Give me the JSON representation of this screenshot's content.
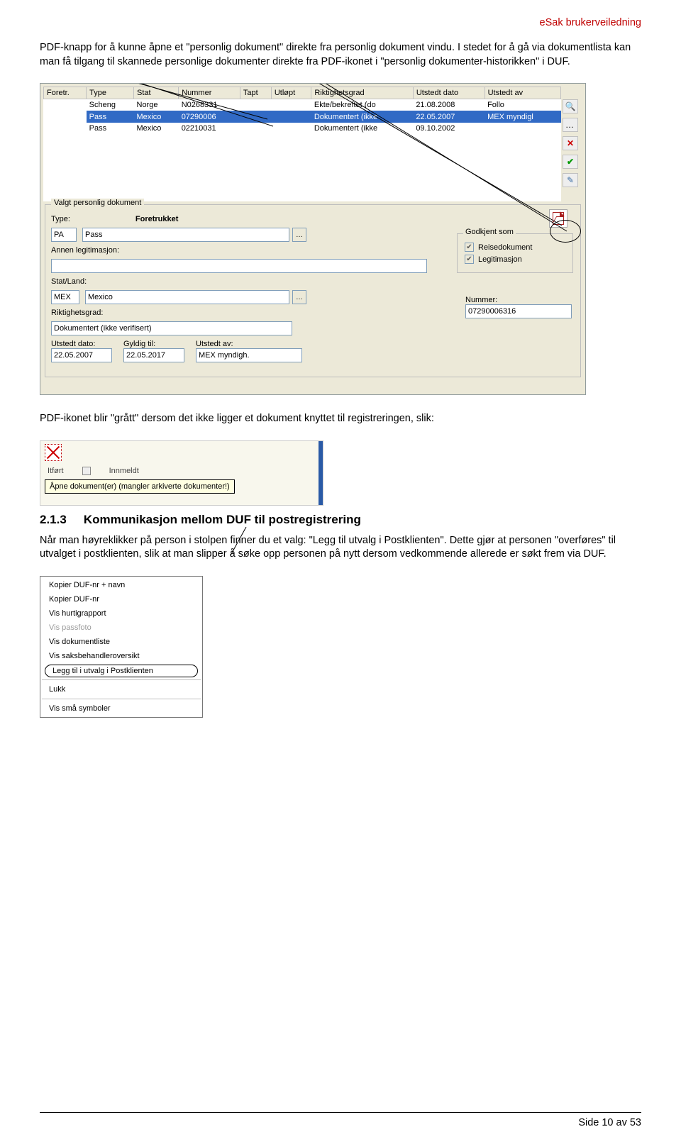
{
  "header": {
    "title": "eSak brukerveiledning"
  },
  "para1": "PDF-knapp for å kunne åpne et \"personlig dokument\" direkte fra personlig dokument vindu. I stedet for å gå via dokumentlista kan man få tilgang til skannede personlige dokumenter direkte fra PDF-ikonet i \"personlig dokumenter-historikken\" i DUF.",
  "screenshot1": {
    "headers": [
      "Foretr.",
      "Type",
      "Stat",
      "Nummer",
      "Tapt",
      "Utløpt",
      "Riktighetsgrad",
      "Utstedt dato",
      "Utstedt av"
    ],
    "rows": [
      {
        "cells": [
          "",
          "Scheng",
          "Norge",
          "N0268331",
          "",
          "",
          "Ekte/bekreftet (do",
          "21.08.2008",
          "Follo"
        ]
      },
      {
        "cells": [
          "✔",
          "Pass",
          "Mexico",
          "07290006",
          "",
          "",
          "Dokumentert (ikke",
          "22.05.2007",
          "MEX myndigl"
        ],
        "selected": true
      },
      {
        "cells": [
          "",
          "Pass",
          "Mexico",
          "02210031",
          "",
          "",
          "Dokumentert (ikke",
          "09.10.2002",
          ""
        ]
      }
    ],
    "sideIcons": [
      "search-icon",
      "dots-icon",
      "delete-icon",
      "check-icon",
      "edit-icon"
    ],
    "panel": {
      "legend": "Valgt personlig dokument",
      "type_label": "Type:",
      "foretrukket": "Foretrukket",
      "pa": "PA",
      "pass": "Pass",
      "annen_label": "Annen legitimasjon:",
      "stat_label": "Stat/Land:",
      "stat_code": "MEX",
      "stat_name": "Mexico",
      "nummer_label": "Nummer:",
      "nummer": "07290006316",
      "riktighet_label": "Riktighetsgrad:",
      "riktighet": "Dokumentert (ikke verifisert)",
      "utstedt_dato_label": "Utstedt dato:",
      "utstedt_dato": "22.05.2007",
      "gyldig_label": "Gyldig til:",
      "gyldig": "22.05.2017",
      "utstedt_av_label": "Utstedt av:",
      "utstedt_av": "MEX myndigh.",
      "godkjent": {
        "legend": "Godkjent som",
        "reise": "Reisedokument",
        "legit": "Legitimasjon"
      }
    }
  },
  "para2": "PDF-ikonet blir \"grått\" dersom det ikke ligger et dokument knyttet til registreringen, slik:",
  "screenshot2": {
    "word1": "Itført",
    "word2": "Innmeldt",
    "tooltip": "Åpne dokument(er) (mangler arkiverte dokumenter!)"
  },
  "section": {
    "number": "2.1.3",
    "title": "Kommunikasjon mellom DUF til postregistrering"
  },
  "para3": "Når man høyreklikker på person i stolpen finner du et valg: \"Legg til utvalg i Postklienten\". Dette gjør at personen \"overføres\" til utvalget i postklienten, slik at man slipper å søke opp personen på nytt dersom vedkommende allerede er søkt frem via DUF.",
  "screenshot3": {
    "items": [
      {
        "label": "Kopier DUF-nr + navn",
        "disabled": false
      },
      {
        "label": "Kopier DUF-nr",
        "disabled": false
      },
      {
        "label": "Vis hurtigrapport",
        "disabled": false
      },
      {
        "label": "Vis passfoto",
        "disabled": true
      },
      {
        "label": "Vis dokumentliste",
        "disabled": false
      },
      {
        "label": "Vis saksbehandleroversikt",
        "disabled": false
      }
    ],
    "circled": "Legg til i utvalg i Postklienten",
    "after": [
      {
        "label": "Lukk",
        "disabled": false
      },
      {
        "label": "Vis små symboler",
        "disabled": false
      }
    ]
  },
  "footer": "Side 10 av 53"
}
